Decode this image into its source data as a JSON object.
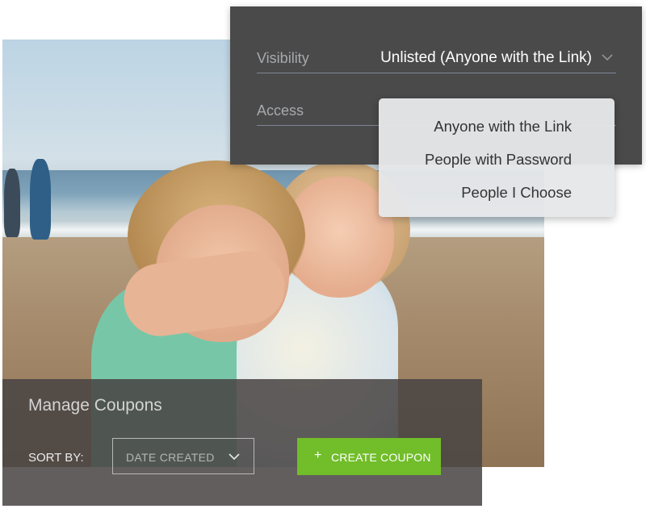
{
  "visibility_panel": {
    "visibility_label": "Visibility",
    "visibility_value": "Unlisted (Anyone with the Link)",
    "access_label": "Access",
    "dropdown_options": [
      "Anyone with the Link",
      "People with Password",
      "People I Choose"
    ]
  },
  "coupons": {
    "title": "Manage Coupons",
    "sort_label": "SORT BY:",
    "sort_value": "DATE CREATED",
    "create_button_icon": "+",
    "create_button_label": "CREATE COUPON"
  },
  "colors": {
    "accent_green": "#71bd2a",
    "panel_dark": "#4a4a4a",
    "dropdown_bg": "#e6e7e9"
  },
  "icons": [
    "chevron-down-icon",
    "plus-icon"
  ]
}
